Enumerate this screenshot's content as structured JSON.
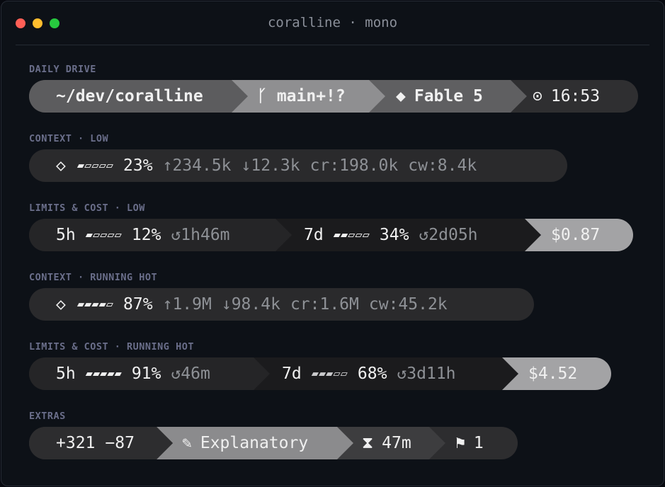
{
  "window": {
    "title": "coralline · mono",
    "controls": {
      "close_color": "#ff5f56",
      "minimize_color": "#ffbd2e",
      "maximize_color": "#27c93f"
    }
  },
  "sections": {
    "daily": {
      "label": "DAILY DRIVE",
      "path": "~/dev/coralline",
      "branch_icon": "git-branch-icon",
      "branch_glyph": "ᚴ",
      "branch": "main+!?",
      "model_glyph": "◆",
      "model": "Fable 5",
      "clock_glyph": "⊙",
      "time": "16:53"
    },
    "context_low": {
      "label": "CONTEXT · LOW",
      "icon_glyph": "◇",
      "gauge": "▰▱▱▱▱",
      "percent": "23%",
      "up": "↑234.5k",
      "down": "↓12.3k",
      "cr": "cr:198.0k",
      "cw": "cw:8.4k"
    },
    "limits_low": {
      "label": "LIMITS & COST · LOW",
      "w5_label": "5h",
      "w5_gauge": "▰▱▱▱▱",
      "w5_percent": "12%",
      "w5_reset": "↺1h46m",
      "w7_label": "7d",
      "w7_gauge": "▰▰▱▱▱",
      "w7_percent": "34%",
      "w7_reset": "↺2d05h",
      "cost": "$0.87"
    },
    "context_hot": {
      "label": "CONTEXT · RUNNING HOT",
      "icon_glyph": "◇",
      "gauge": "▰▰▰▰▱",
      "percent": "87%",
      "up": "↑1.9M",
      "down": "↓98.4k",
      "cr": "cr:1.6M",
      "cw": "cw:45.2k"
    },
    "limits_hot": {
      "label": "LIMITS & COST · RUNNING HOT",
      "w5_label": "5h",
      "w5_gauge": "▰▰▰▰▰",
      "w5_percent": "91%",
      "w5_reset": "↺46m",
      "w7_label": "7d",
      "w7_gauge": "▰▰▰▱▱",
      "w7_percent": "68%",
      "w7_reset": "↺3d11h",
      "cost": "$4.52"
    },
    "extras": {
      "label": "EXTRAS",
      "added": "+321",
      "removed": "−87",
      "style_glyph": "✎",
      "style": "Explanatory",
      "duration_glyph": "⧗",
      "duration": "47m",
      "flag_glyph": "⚑",
      "flags": "1"
    }
  }
}
